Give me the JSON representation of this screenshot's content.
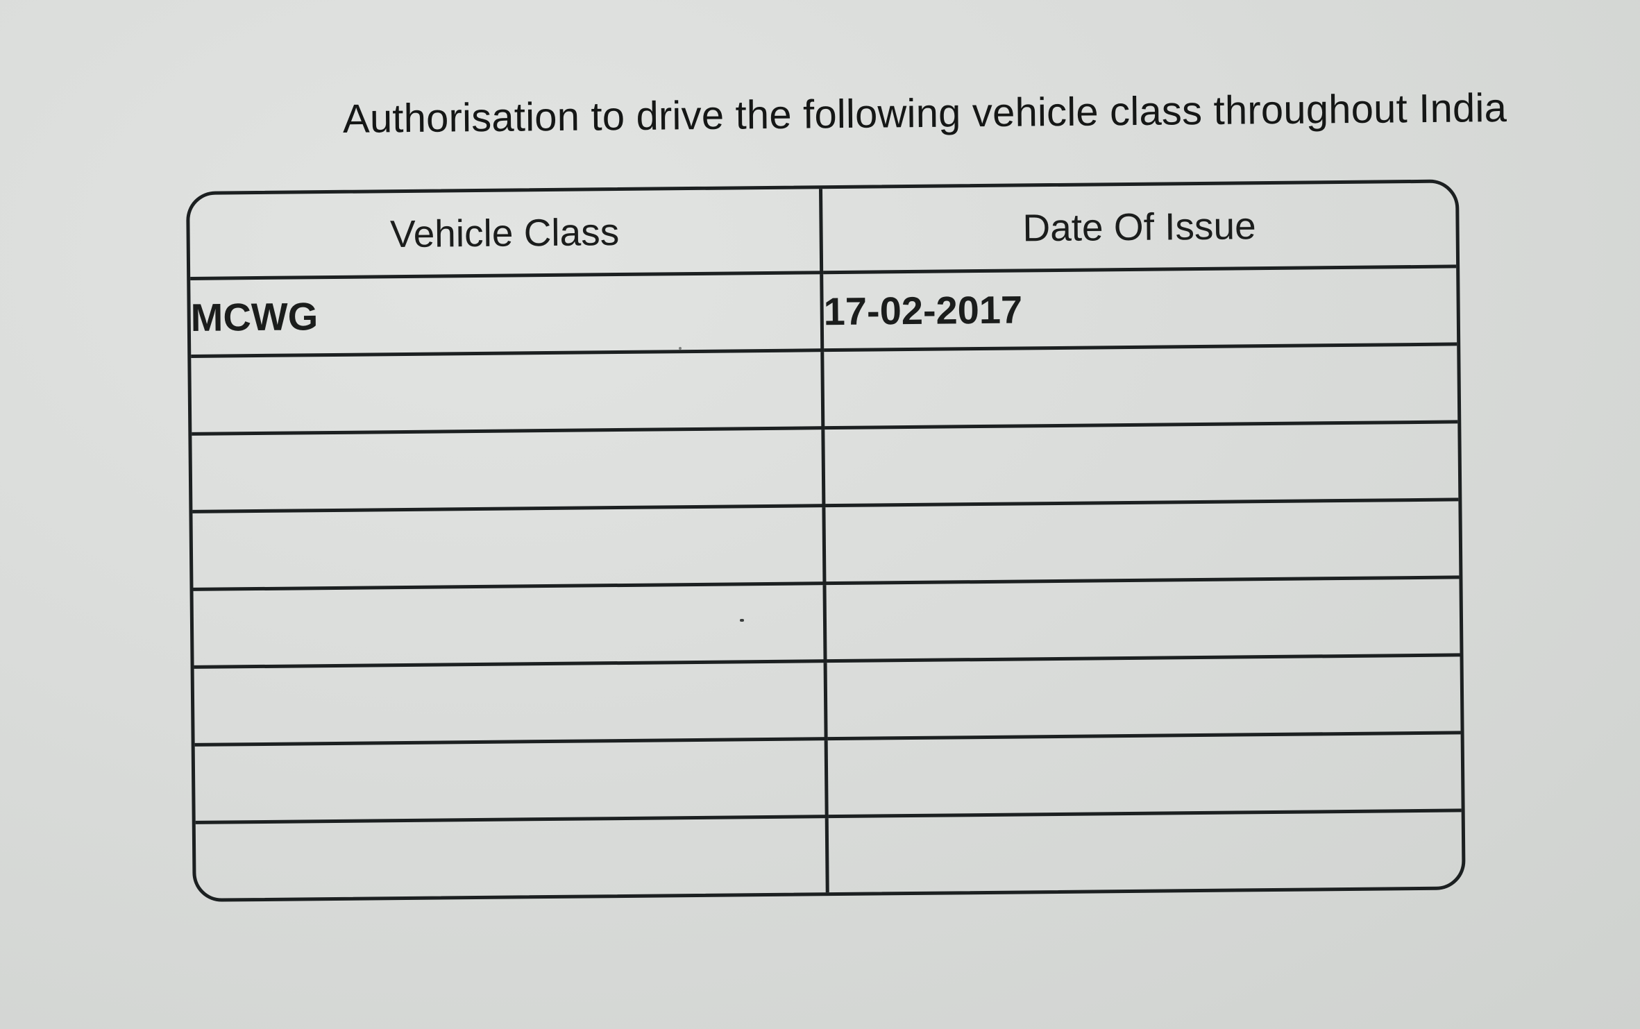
{
  "heading": "Authorisation to drive the following vehicle class throughout India",
  "table": {
    "columns": [
      "Vehicle Class",
      "Date Of Issue"
    ],
    "rows": [
      [
        "MCWG",
        "17-02-2017"
      ],
      [
        "",
        ""
      ],
      [
        "",
        ""
      ],
      [
        "",
        ""
      ],
      [
        "",
        ""
      ],
      [
        "",
        ""
      ],
      [
        "",
        ""
      ],
      [
        "",
        ""
      ]
    ]
  }
}
